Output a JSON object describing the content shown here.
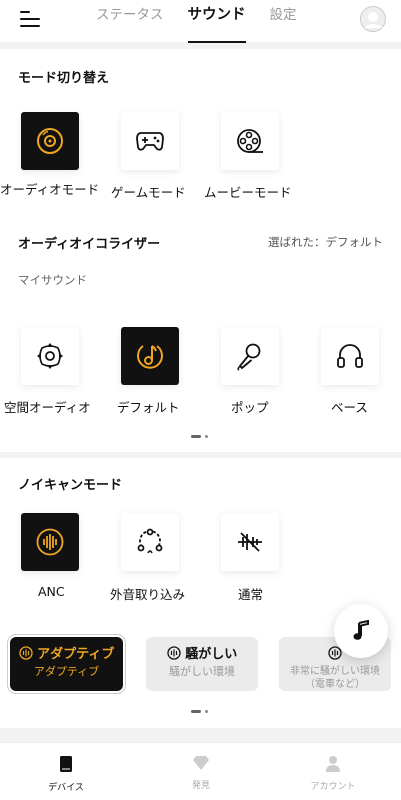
{
  "header": {
    "tabs": [
      {
        "label": "ステータス",
        "active": false
      },
      {
        "label": "サウンド",
        "active": true
      },
      {
        "label": "設定",
        "active": false
      }
    ]
  },
  "mode_switch": {
    "title": "モード切り替え",
    "modes": [
      {
        "label": "オーディオモード",
        "icon": "disc-icon",
        "selected": true
      },
      {
        "label": "ゲームモード",
        "icon": "gamepad-icon",
        "selected": false
      },
      {
        "label": "ムービーモード",
        "icon": "film-reel-icon",
        "selected": false
      }
    ]
  },
  "equalizer": {
    "title": "オーディオイコライザー",
    "selected_text": "選ばれた：デフォルト",
    "my_sound": "マイサウンド",
    "presets": [
      {
        "label": "空間オーディオ",
        "icon": "spatial-audio-icon",
        "selected": false
      },
      {
        "label": "デフォルト",
        "icon": "music-note-circle-icon",
        "selected": true
      },
      {
        "label": "ポップ",
        "icon": "microphone-icon",
        "selected": false
      },
      {
        "label": "ベース",
        "icon": "headphones-icon",
        "selected": false
      }
    ]
  },
  "noise_cancel": {
    "title": "ノイキャンモード",
    "modes": [
      {
        "label": "ANC",
        "icon": "sound-wave-icon",
        "selected": true
      },
      {
        "label": "外音取り込み",
        "icon": "ambient-network-icon",
        "selected": false
      },
      {
        "label": "通常",
        "icon": "off-wave-icon",
        "selected": false
      }
    ],
    "levels": [
      {
        "title": "アダプティブ",
        "subtitle": "アダプティブ",
        "selected": true
      },
      {
        "title": "騒がしい",
        "subtitle": "騒がしい環境",
        "selected": false
      },
      {
        "title": "",
        "subtitle": "非常に騒がしい環境（電車など）",
        "selected": false
      }
    ]
  },
  "bottom_nav": {
    "items": [
      {
        "label": "デバイス",
        "active": true
      },
      {
        "label": "発見",
        "active": false
      },
      {
        "label": "アカウント",
        "active": false
      }
    ]
  },
  "colors": {
    "accent": "#f0a623",
    "dark": "#111111"
  }
}
